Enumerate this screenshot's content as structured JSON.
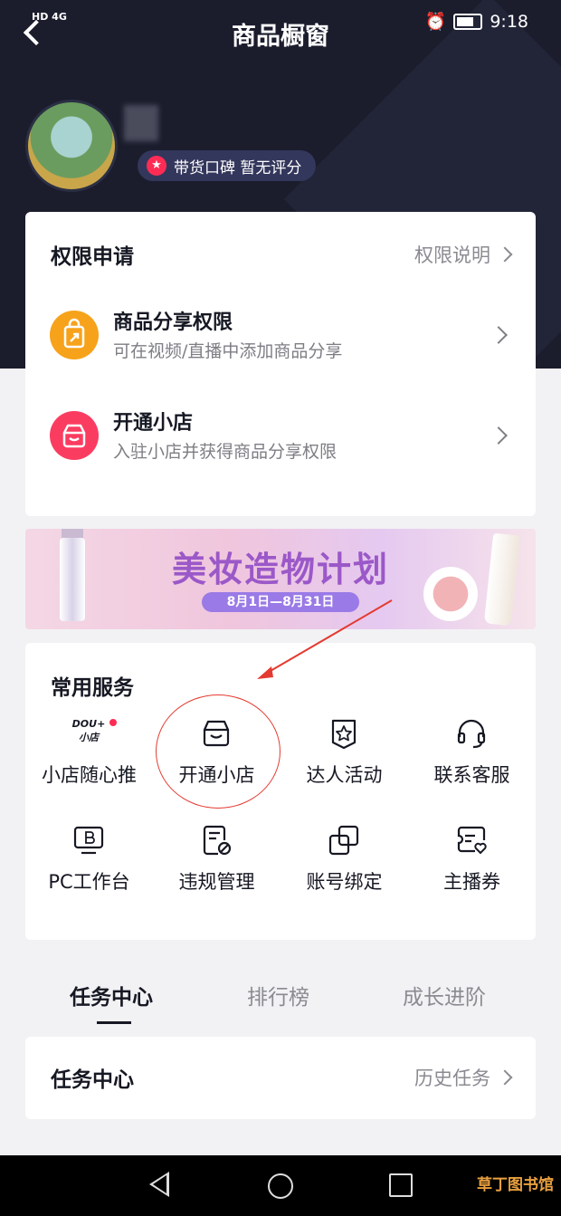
{
  "status_bar": {
    "network": "HD 4G",
    "time": "9:18"
  },
  "header": {
    "title": "商品橱窗"
  },
  "profile": {
    "rating_label": "带货口碑 暂无评分"
  },
  "permission_card": {
    "title": "权限申请",
    "more_label": "权限说明",
    "items": [
      {
        "title": "商品分享权限",
        "desc": "可在视频/直播中添加商品分享",
        "icon": "share-bag-icon",
        "color": "#f7a21b"
      },
      {
        "title": "开通小店",
        "desc": "入驻小店并获得商品分享权限",
        "icon": "store-icon",
        "color": "#fb3c61"
      }
    ]
  },
  "banner": {
    "title": "美妆造物计划",
    "date_range": "8月1日—8月31日"
  },
  "services": {
    "title": "常用服务",
    "items": [
      {
        "label": "小店随心推",
        "icon": "dou-plus-store-icon",
        "badge": true
      },
      {
        "label": "开通小店",
        "icon": "store-icon",
        "highlighted": true
      },
      {
        "label": "达人活动",
        "icon": "star-badge-icon"
      },
      {
        "label": "联系客服",
        "icon": "headset-icon"
      },
      {
        "label": "PC工作台",
        "icon": "pc-monitor-icon"
      },
      {
        "label": "违规管理",
        "icon": "violation-doc-icon"
      },
      {
        "label": "账号绑定",
        "icon": "link-icon"
      },
      {
        "label": "主播券",
        "icon": "coupon-icon"
      }
    ],
    "dou_logo_top": "DOU+",
    "dou_logo_bottom": "小店"
  },
  "tabs": [
    {
      "label": "任务中心",
      "active": true
    },
    {
      "label": "排行榜",
      "active": false
    },
    {
      "label": "成长进阶",
      "active": false
    }
  ],
  "task_card": {
    "title": "任务中心",
    "more_label": "历史任务"
  },
  "watermark": "草丁图书馆",
  "colors": {
    "accent": "#fe2c55",
    "header_bg": "#1b1d2d",
    "annotation": "#e43a31"
  }
}
